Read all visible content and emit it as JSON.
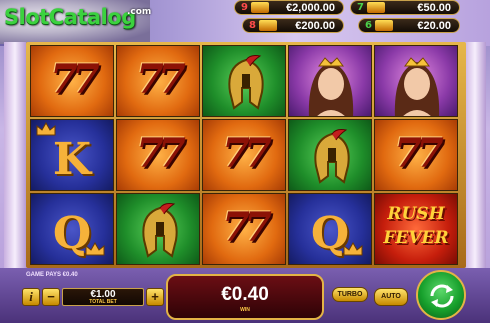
{
  "watermark": {
    "brand": "SlotCatalog",
    "suffix": ".com"
  },
  "jackpots": [
    {
      "count": "9",
      "badge": "rush-fever-badge",
      "value": "€2,000.00"
    },
    {
      "count": "7",
      "badge": "rush-fever-badge",
      "value": "€50.00"
    },
    {
      "count": "8",
      "badge": "rush-fever-badge",
      "value": "€200.00"
    },
    {
      "count": "6",
      "badge": "rush-fever-badge",
      "value": "€20.00"
    }
  ],
  "jackpot_colors": [
    "#ff4b4b",
    "#4bd24b"
  ],
  "reels": [
    [
      "seven",
      "royal-K",
      "royal-Q"
    ],
    [
      "seven",
      "seven",
      "warrior"
    ],
    [
      "warrior",
      "seven",
      "seven"
    ],
    [
      "queen",
      "warrior",
      "royal-Q"
    ],
    [
      "queen",
      "seven",
      "rush-fever"
    ]
  ],
  "symbols": {
    "seven_text": "77",
    "k_text": "K",
    "q_text": "Q",
    "rush_line1": "RUSH",
    "rush_line2": "FEVER"
  },
  "game_pays": "GAME PAYS €0.40",
  "bet": {
    "value": "€1.00",
    "label": "TOTAL BET",
    "minus": "−",
    "plus": "+",
    "info": "i"
  },
  "win": {
    "value": "€0.40",
    "label": "WIN"
  },
  "buttons": {
    "turbo": "TURBO",
    "auto": "AUTO"
  },
  "colors": {
    "frame_gold": "#e3b446",
    "spin_green": "#17a02c",
    "win_red": "#6b0e14"
  }
}
